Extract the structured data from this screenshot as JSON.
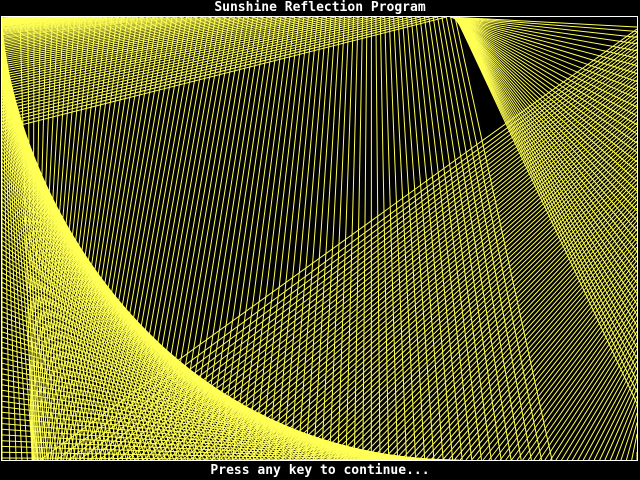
{
  "window": {
    "title": "Sunshine Reflection Program"
  },
  "status": {
    "prompt": "Press any key to continue..."
  },
  "colors": {
    "background": "#000000",
    "frame": "#ffffff",
    "rays": "#ffff55",
    "text": "#ffffff"
  }
}
